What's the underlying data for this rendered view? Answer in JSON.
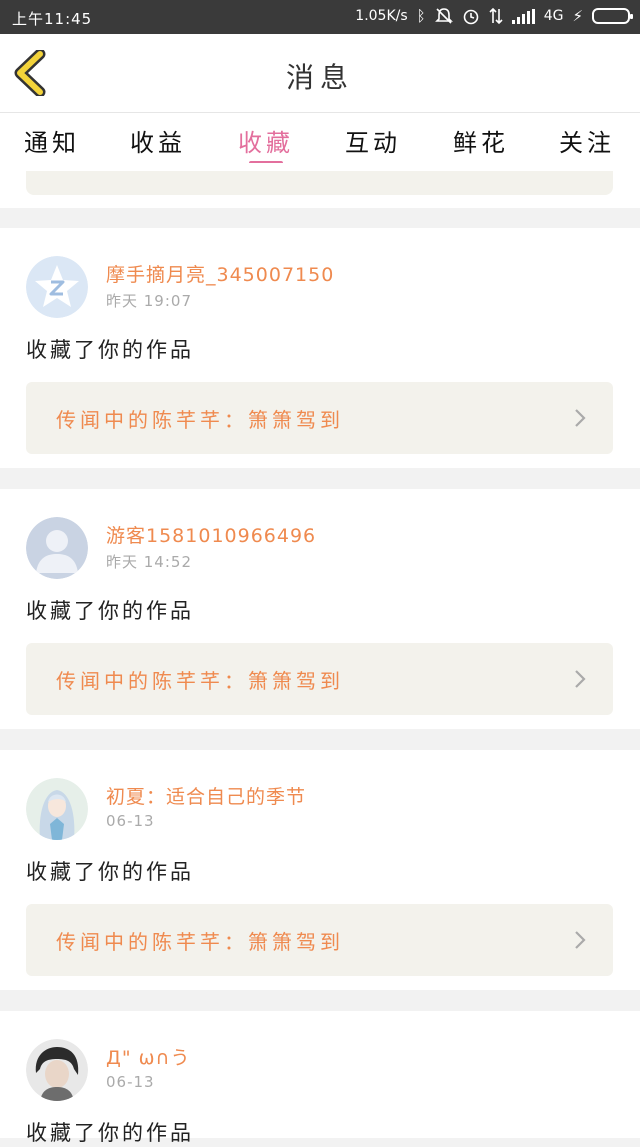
{
  "status_bar": {
    "time": "上午11:45",
    "speed": "1.05K/s",
    "network": "4G",
    "icons": [
      "bluetooth-icon",
      "mute-icon",
      "alarm-icon",
      "data-transfer-icon",
      "signal-icon",
      "battery-icon"
    ]
  },
  "header": {
    "title": "消息",
    "back_icon": "chevron-left-icon",
    "accent": "#f3d33a"
  },
  "tabs": [
    {
      "label": "通知",
      "active": false
    },
    {
      "label": "收益",
      "active": false
    },
    {
      "label": "收藏",
      "active": true
    },
    {
      "label": "互动",
      "active": false
    },
    {
      "label": "鲜花",
      "active": false
    },
    {
      "label": "关注",
      "active": false
    }
  ],
  "colors": {
    "active_tab": "#e36f9d",
    "name": "#ef8a4f",
    "work_bg": "#f3f2ec"
  },
  "messages": [
    {
      "user": "摩手摘月亮_345007150",
      "time": "昨天 19:07",
      "action": "收藏了你的作品",
      "work": "传闻中的陈芊芊：箫箫驾到",
      "avatar": "qq-avatar-icon"
    },
    {
      "user": "游客1581010966496",
      "time": "昨天 14:52",
      "action": "收藏了你的作品",
      "work": "传闻中的陈芊芊：箫箫驾到",
      "avatar": "default-person-avatar-icon"
    },
    {
      "user": "初夏：适合自己的季节",
      "time": "06-13",
      "action": "收藏了你的作品",
      "work": "传闻中的陈芊芊：箫箫驾到",
      "avatar": "anime-girl-avatar"
    },
    {
      "user": "Д\" ω∩う",
      "time": "06-13",
      "action": "收藏了你的作品",
      "work": "",
      "avatar": "photo-avatar"
    }
  ]
}
